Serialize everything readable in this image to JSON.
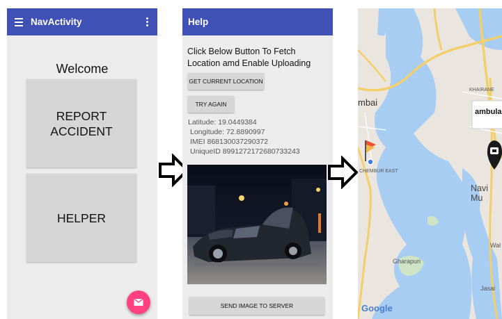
{
  "screen1": {
    "title": "NavActivity",
    "welcome": "Welcome",
    "report_label": "REPORT\nACCIDENT",
    "helper_label": "HELPER"
  },
  "screen2": {
    "title": "Help",
    "instruction": "Click Below Button To Fetch Location amd Enable Uploading",
    "get_location_label": "GET CURRENT LOCATION",
    "try_again_label": "TRY AGAIN",
    "latitude": "Latitude: 19.0449384",
    "longitude": "Longitude: 72.8890997",
    "imei": "IMEI 868130037290372",
    "unique_id": "UniqueID 8991272172680733243",
    "send_label": "SEND IMAGE TO SERVER"
  },
  "screen3": {
    "labels": {
      "mbai": "mbai",
      "kharane": "KHAIRANE",
      "ambula": "ambula",
      "chembur": "CHEMBUR EAST",
      "navi": "Navi Mu",
      "gharapuri": "Gharapuri",
      "wal": "Wal",
      "jasai": "Jasai"
    },
    "attribution": "Google"
  },
  "colors": {
    "appbar": "#3f51b5",
    "fab": "#ff4081",
    "water": "#a7cdf2",
    "land": "#eae6df",
    "road": "#f3cf6a"
  }
}
